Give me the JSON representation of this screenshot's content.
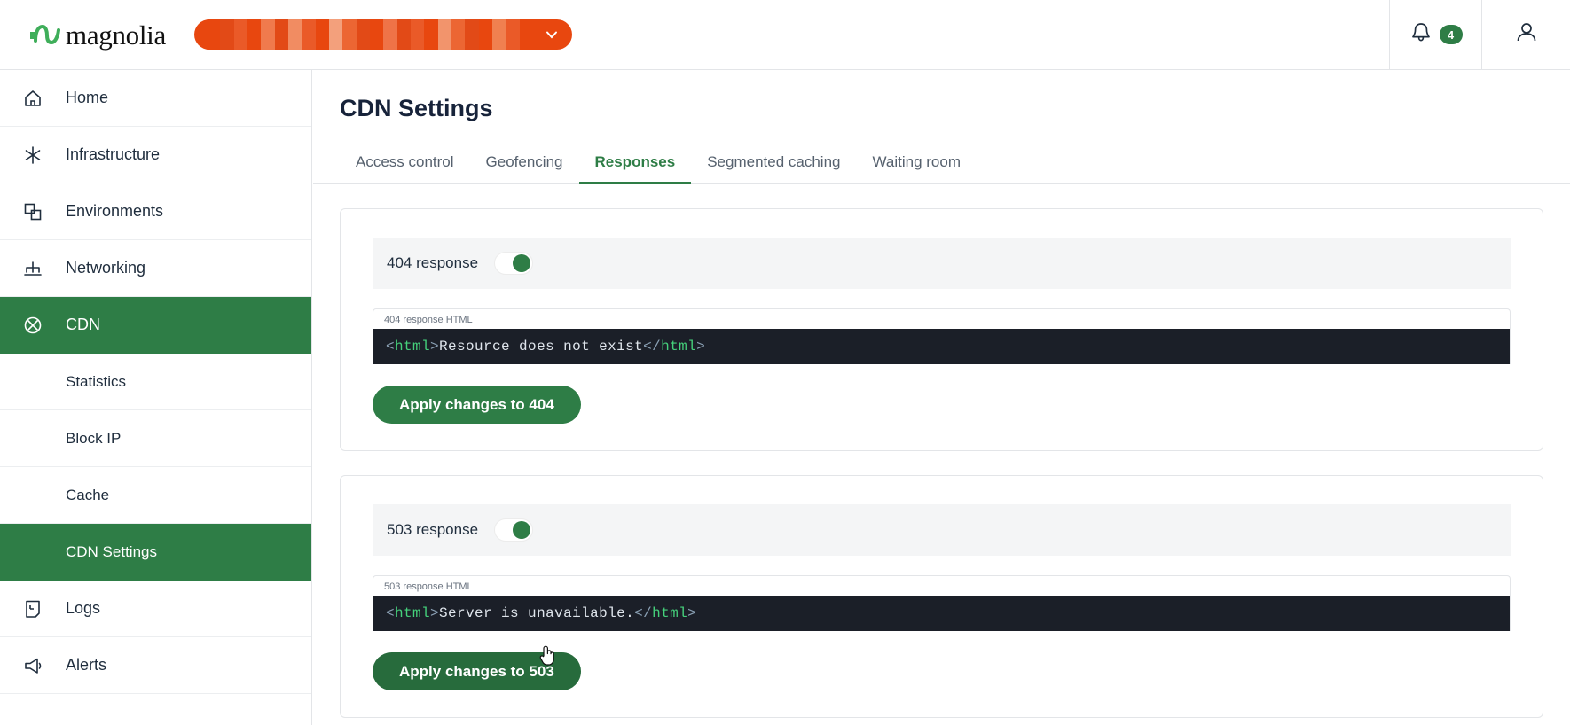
{
  "topbar": {
    "brand_name": "magnolia",
    "brand_mark_icon": "magnolia-wave-logo",
    "env_selector": {
      "value": "",
      "redacted": true,
      "chevron_icon": "chevron-down-icon",
      "accent_color": "#e8470f"
    },
    "notifications": {
      "icon": "bell-icon",
      "count": "4",
      "badge_color": "#2e7d46"
    },
    "account": {
      "icon": "user-icon"
    }
  },
  "sidebar": {
    "items": [
      {
        "label": "Home",
        "icon": "home-icon",
        "active": false,
        "sub": false
      },
      {
        "label": "Infrastructure",
        "icon": "asterisk-icon",
        "active": false,
        "sub": false
      },
      {
        "label": "Environments",
        "icon": "stacked-squares-icon",
        "active": false,
        "sub": false
      },
      {
        "label": "Networking",
        "icon": "network-icon",
        "active": false,
        "sub": false
      },
      {
        "label": "CDN",
        "icon": "circle-x-icon",
        "active": true,
        "sub": false
      },
      {
        "label": "Statistics",
        "icon": "",
        "active": false,
        "sub": true
      },
      {
        "label": "Block IP",
        "icon": "",
        "active": false,
        "sub": true
      },
      {
        "label": "Cache",
        "icon": "",
        "active": false,
        "sub": true
      },
      {
        "label": "CDN Settings",
        "icon": "",
        "active": true,
        "sub": true
      },
      {
        "label": "Logs",
        "icon": "document-icon",
        "active": false,
        "sub": false
      },
      {
        "label": "Alerts",
        "icon": "megaphone-icon",
        "active": false,
        "sub": false
      }
    ]
  },
  "main": {
    "page_title": "CDN Settings",
    "tabs": [
      {
        "label": "Access control",
        "active": false
      },
      {
        "label": "Geofencing",
        "active": false
      },
      {
        "label": "Responses",
        "active": true
      },
      {
        "label": "Segmented caching",
        "active": false
      },
      {
        "label": "Waiting room",
        "active": false
      }
    ],
    "cards": [
      {
        "toggle_label": "404 response",
        "toggle_on": true,
        "field_label": "404 response HTML",
        "code": {
          "open_lt": "<",
          "open_tag": "html",
          "open_gt": ">",
          "text": "Resource does not exist",
          "close_lt": "</",
          "close_tag": "html",
          "close_gt": ">"
        },
        "apply_label": "Apply changes to 404",
        "apply_hover": false
      },
      {
        "toggle_label": "503 response",
        "toggle_on": true,
        "field_label": "503 response HTML",
        "code": {
          "open_lt": "<",
          "open_tag": "html",
          "open_gt": ">",
          "text": "Server is unavailable.",
          "close_lt": "</",
          "close_tag": "html",
          "close_gt": ">"
        },
        "apply_label": "Apply changes to 503",
        "apply_hover": true
      }
    ]
  },
  "cursor": {
    "icon": "pointer-hand-cursor",
    "over": "apply-503-button"
  }
}
